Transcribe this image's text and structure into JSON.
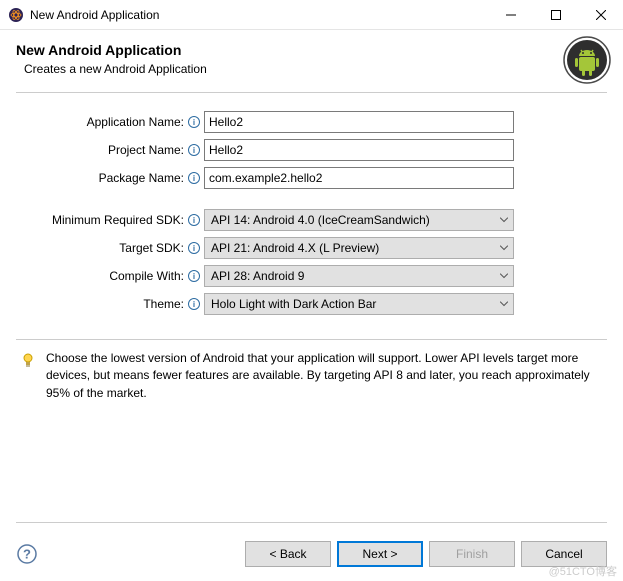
{
  "window": {
    "title": "New Android Application"
  },
  "header": {
    "title": "New Android Application",
    "subtitle": "Creates a new Android Application"
  },
  "form": {
    "appName": {
      "label": "Application Name:",
      "value": "Hello2"
    },
    "projName": {
      "label": "Project Name:",
      "value": "Hello2"
    },
    "pkgName": {
      "label": "Package Name:",
      "value": "com.example2.hello2"
    },
    "minSdk": {
      "label": "Minimum Required SDK:",
      "value": "API 14: Android 4.0 (IceCreamSandwich)"
    },
    "targetSdk": {
      "label": "Target SDK:",
      "value": "API 21: Android 4.X (L Preview)"
    },
    "compileWith": {
      "label": "Compile With:",
      "value": "API 28: Android 9"
    },
    "theme": {
      "label": "Theme:",
      "value": "Holo Light with Dark Action Bar"
    }
  },
  "hint": {
    "text": "Choose the lowest version of Android that your application will support. Lower API levels target more devices, but means fewer features are available. By targeting API 8 and later, you reach approximately 95% of the market."
  },
  "buttons": {
    "back": "< Back",
    "next": "Next >",
    "finish": "Finish",
    "cancel": "Cancel"
  },
  "watermark": "@51CTO博客"
}
